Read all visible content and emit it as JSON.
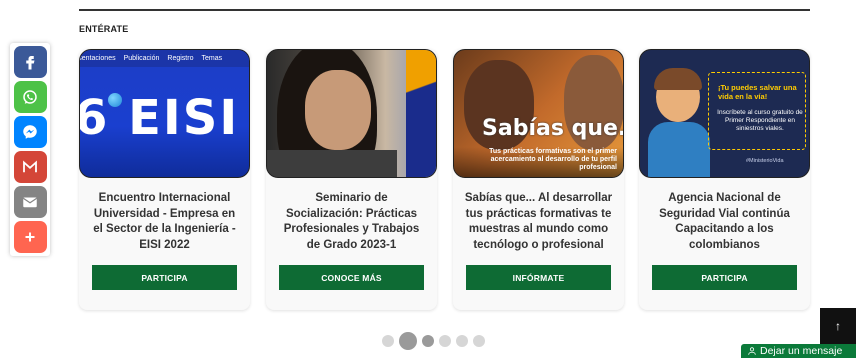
{
  "section": {
    "title": "ENTÉRATE"
  },
  "share": {
    "items": [
      {
        "name": "facebook",
        "icon": "facebook-icon",
        "color": "#3b5998"
      },
      {
        "name": "whatsapp",
        "icon": "whatsapp-icon",
        "color": "#4dc247"
      },
      {
        "name": "messenger",
        "icon": "messenger-icon",
        "color": "#0084ff"
      },
      {
        "name": "gmail",
        "icon": "gmail-icon",
        "color": "#d44638"
      },
      {
        "name": "email",
        "icon": "email-icon",
        "color": "#848484"
      },
      {
        "name": "more",
        "icon": "plus-icon",
        "color": "#ff6550"
      }
    ]
  },
  "cards": [
    {
      "image": {
        "menu": [
          "resentaciones",
          "Publicación",
          "Registro",
          "Temas"
        ],
        "headline": "6 EISI"
      },
      "title": "Encuentro Internacional Universidad - Empresa en el Sector de la Ingeniería - EISI 2022",
      "button": "PARTICIPA"
    },
    {
      "title": "Seminario de Socialización: Prácticas Profesionales y Trabajos de Grado 2023-1",
      "button": "CONOCE MÁS"
    },
    {
      "image": {
        "headline": "Sabías que...",
        "subtext": "Tus prácticas formativas son el primer acercamiento al desarrollo de tu perfil profesional"
      },
      "title": "Sabías que... Al desarrollar tus prácticas formativas te muestras al mundo como tecnólogo o profesional",
      "button": "INFÓRMATE"
    },
    {
      "image": {
        "headline": "¡Tu puedes salvar una vida en la vía!",
        "body": "Inscríbete al curso gratuito de Primer Respondiente en siniestros viales.",
        "tag": "#MinisterioVida"
      },
      "title": "Agencia Nacional de Seguridad Vial continúa Capacitando a los colombianos",
      "button": "PARTICIPA"
    }
  ],
  "pager": {
    "count": 6,
    "active_index": 1
  },
  "scroll_top": {
    "label": "↑"
  },
  "chat": {
    "label": "Dejar un mensaje"
  },
  "colors": {
    "accent_green": "#0e6b34",
    "chat_green": "#0b7a3a"
  }
}
